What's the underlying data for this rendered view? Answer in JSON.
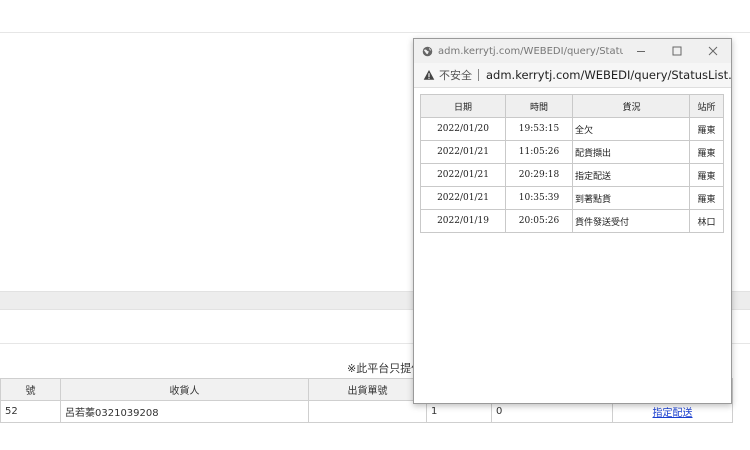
{
  "background": {
    "notice": "※此平台只提供",
    "table": {
      "headers": [
        "號",
        "收貨人",
        "出貨單號",
        "",
        "",
        ""
      ],
      "row": [
        "52",
        "呂若蓁0321039208",
        "",
        "1",
        "0",
        "指定配送"
      ]
    }
  },
  "popup": {
    "title": "adm.kerrytj.com/WEBEDI/query/StatusLi...",
    "insecure_label": "不安全",
    "url": "adm.kerrytj.com/WEBEDI/query/StatusList....",
    "table": {
      "headers": [
        "日期",
        "時間",
        "貨況",
        "站所"
      ],
      "rows": [
        [
          "2022/01/20",
          "19:53:15",
          "全欠",
          "羅東"
        ],
        [
          "2022/01/21",
          "11:05:26",
          "配貨擷出",
          "羅東"
        ],
        [
          "2022/01/21",
          "20:29:18",
          "指定配送",
          "羅東"
        ],
        [
          "2022/01/21",
          "10:35:39",
          "到著點貨",
          "羅東"
        ],
        [
          "2022/01/19",
          "20:05:26",
          "貨件發送受付",
          "林口"
        ]
      ]
    }
  }
}
